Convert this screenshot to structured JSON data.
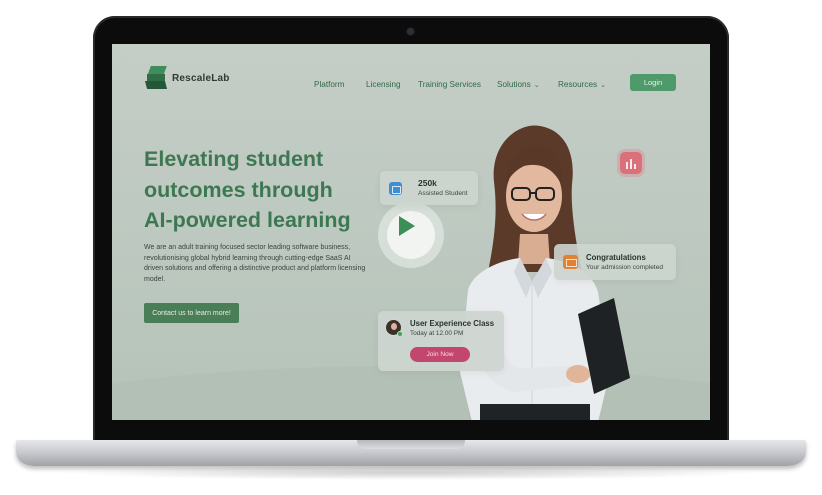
{
  "brand": {
    "name": "RescaleLab",
    "accent": "#3d7852",
    "button_green": "#4f9a6a",
    "join_pink": "#c3466e"
  },
  "nav": {
    "items": [
      {
        "label": "Platform",
        "has_dropdown": false
      },
      {
        "label": "Licensing",
        "has_dropdown": false
      },
      {
        "label": "Training Services",
        "has_dropdown": false
      },
      {
        "label": "Solutions",
        "has_dropdown": true
      },
      {
        "label": "Resources",
        "has_dropdown": true
      }
    ],
    "login_label": "Login"
  },
  "hero": {
    "title_lines": [
      "Elevating student",
      "outcomes through",
      "AI-powered learning"
    ],
    "description": "We are an adult training focused sector leading software business, revolutionising global hybrid learning through cutting-edge SaaS AI driven solutions and offering a distinctive product and platform licensing model.",
    "cta_label": "Contact us to learn more!"
  },
  "cards": {
    "assisted": {
      "value": "250k",
      "label": "Assisted Student",
      "icon": "calendar-icon"
    },
    "congrats": {
      "title": "Congratulations",
      "subtitle": "Your admission completed",
      "icon": "mail-icon"
    },
    "class": {
      "title": "User Experience Class",
      "time": "Today at 12.00 PM",
      "join_label": "Join Now"
    }
  },
  "icons": {
    "play": "play-icon",
    "chart": "bar-chart-icon",
    "chevron": "chevron-down-icon"
  }
}
